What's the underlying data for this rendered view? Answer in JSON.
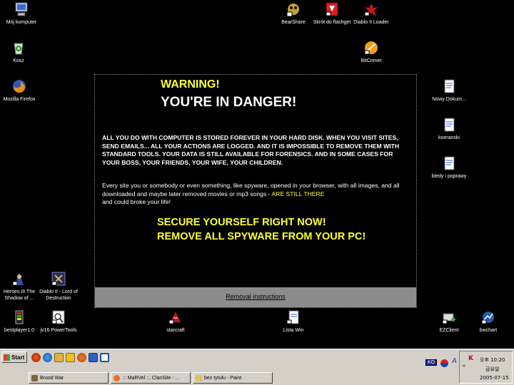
{
  "desktop_icons": [
    {
      "id": "moj-komputer",
      "label": "Mój komputer",
      "icon": "computer-icon"
    },
    {
      "id": "kosz",
      "label": "Kosz",
      "icon": "recycle-bin-icon"
    },
    {
      "id": "firefox",
      "label": "Mozilla Firefox",
      "icon": "firefox-icon"
    },
    {
      "id": "bearshare",
      "label": "BearShare",
      "icon": "bearshare-icon"
    },
    {
      "id": "flashget",
      "label": "Skrót do flashget",
      "icon": "flashget-icon"
    },
    {
      "id": "diablo-loader",
      "label": "Diablo II Loader",
      "icon": "diablo-icon"
    },
    {
      "id": "bitcomet",
      "label": "BitComet",
      "icon": "bitcomet-icon"
    },
    {
      "id": "nowy-dokum",
      "label": "Nowy Dokum...",
      "icon": "document-icon"
    },
    {
      "id": "koeranski",
      "label": "koeranski",
      "icon": "document-icon"
    },
    {
      "id": "bledy",
      "label": "bledy i poprawy",
      "icon": "document-icon"
    },
    {
      "id": "heroes3",
      "label": "Heroes III The Shadow of ...",
      "icon": "heroes-icon"
    },
    {
      "id": "diablo-lod",
      "label": "Diablo II - Lord of Destruction",
      "icon": "diablo-lod-icon"
    },
    {
      "id": "bestplayer",
      "label": "bestplayer1.0",
      "icon": "player-icon"
    },
    {
      "id": "jv16",
      "label": "jv16 PowerTools",
      "icon": "jv16-icon"
    },
    {
      "id": "starcraft",
      "label": "starcraft",
      "icon": "starcraft-icon"
    },
    {
      "id": "lista-win",
      "label": "Lista Win",
      "icon": "document-icon"
    },
    {
      "id": "ezclient",
      "label": "EZClient",
      "icon": "ezclient-icon"
    },
    {
      "id": "bwchart",
      "label": "bwchart",
      "icon": "bwchart-icon"
    }
  ],
  "warning": {
    "title": "WARNING!",
    "subtitle": "YOU'RE IN DANGER!",
    "body_bold": "ALL YOU DO WITH COMPUTER IS STORED FOREVER IN YOUR HARD DISK. WHEN YOU VISIT SITES, SEND EMAILS... ALL YOUR ACTIONS ARE LOGGED. AND IT IS IMPOSSIBLE TO REMOVE THEM WITH STANDARD TOOLS. YOUR DATA IS STILL AVAILABLE FOR FORENSICS. AND IN SOME CASES FOR YOUR BOSS, YOUR FRIENDS, YOUR WIFE, YOUR CHILDREN.",
    "body_text": "Every site you or somebody or even something, like spyware, opened in your browser, with all images, and all downloaded and maybe later removed movies or mp3 songs - ",
    "body_highlight": "ARE STILL THERE",
    "body_tail": "and could broke your life!",
    "cta_line1": "SECURE YOURSELF RIGHT NOW!",
    "cta_line2": "REMOVE ALL SPYWARE FROM YOUR PC!",
    "link": "Removal instructions"
  },
  "taskbar": {
    "start_label": "Start",
    "buttons": [
      {
        "label": "Brood War"
      },
      {
        "label": ".:: MaRVel ::. ClanSite - ..."
      },
      {
        "label": "bez tytułu - Paint"
      }
    ],
    "lang_code": "KO",
    "ime_label": "A",
    "chevron": "«",
    "clock_time": "오후 10:20",
    "clock_day": "금요일",
    "clock_date": "2005-07-15"
  },
  "colors": {
    "warning_yellow": "#ffff33",
    "panel_footer": "#8c8c8c",
    "taskbar": "#d4d0c8"
  }
}
